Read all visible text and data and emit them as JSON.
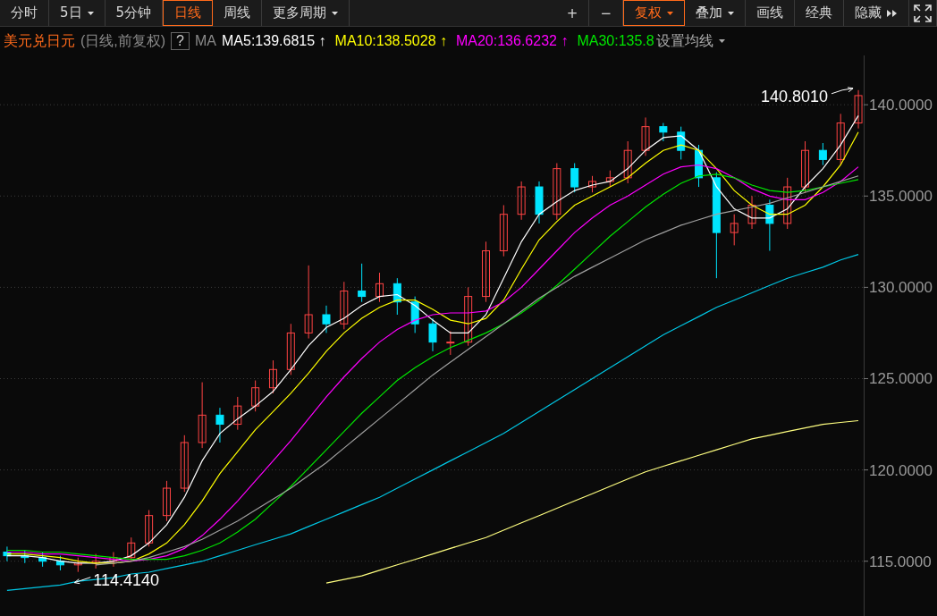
{
  "toolbar": {
    "left_tabs": [
      {
        "label": "分时",
        "selected": false,
        "has_menu": false
      },
      {
        "label": "5日",
        "selected": false,
        "has_menu": true
      },
      {
        "label": "5分钟",
        "selected": false,
        "has_menu": false
      },
      {
        "label": "日线",
        "selected": true,
        "has_menu": false
      },
      {
        "label": "周线",
        "selected": false,
        "has_menu": false
      },
      {
        "label": "更多周期",
        "selected": false,
        "has_menu": true
      }
    ],
    "right_buttons": [
      {
        "label": "+",
        "selected": false,
        "has_menu": false
      },
      {
        "label": "−",
        "selected": false,
        "has_menu": false
      },
      {
        "label": "复权",
        "selected": true,
        "has_menu": true
      },
      {
        "label": "叠加",
        "selected": false,
        "has_menu": true
      },
      {
        "label": "画线",
        "selected": false,
        "has_menu": false
      },
      {
        "label": "经典",
        "selected": false,
        "has_menu": false
      },
      {
        "label": "隐藏",
        "selected": false,
        "has_menu": false
      }
    ]
  },
  "legend": {
    "symbol": "美元兑日元",
    "period": "(日线,前复权)",
    "help": "?",
    "ma_label": "MA",
    "items": [
      {
        "text": "MA5:139.6815",
        "arrow": "↑",
        "color": "#ffffff"
      },
      {
        "text": "MA10:138.5028",
        "arrow": "↑",
        "color": "#ffff00"
      },
      {
        "text": "MA20:136.6232",
        "arrow": "↑",
        "color": "#ff00ff"
      },
      {
        "text": "MA30:135.8",
        "color": "#00e600"
      }
    ],
    "settings": "设置均线"
  },
  "chart": {
    "chart_data": {
      "type": "candlestick",
      "grid": true,
      "categories": [
        null,
        null,
        null,
        null,
        null,
        null,
        null,
        null,
        null,
        null,
        null,
        null,
        null,
        null,
        null,
        null,
        null,
        null,
        null,
        null,
        null,
        null,
        null,
        null,
        null,
        null,
        null,
        null,
        null,
        null,
        null,
        null,
        null,
        null,
        null,
        null,
        null,
        null,
        null,
        null,
        null,
        null,
        null,
        null,
        null,
        null,
        null,
        null,
        null
      ],
      "ylim": [
        112,
        142.7
      ],
      "yticks": [
        {
          "value": 115,
          "label": "115.0000"
        },
        {
          "value": 120,
          "label": "120.0000"
        },
        {
          "value": 125,
          "label": "125.0000"
        },
        {
          "value": 130,
          "label": "130.0000"
        },
        {
          "value": 135,
          "label": "135.0000"
        },
        {
          "value": 140,
          "label": "140.0000"
        }
      ],
      "ohlc": [
        [
          115.5,
          115.8,
          115.0,
          115.3
        ],
        [
          115.3,
          115.6,
          114.9,
          115.2
        ],
        [
          115.2,
          115.5,
          114.7,
          115.0
        ],
        [
          115.0,
          115.3,
          114.5,
          114.8
        ],
        [
          114.8,
          115.2,
          114.414,
          114.9
        ],
        [
          114.9,
          115.4,
          114.6,
          115.0
        ],
        [
          115.0,
          115.5,
          114.7,
          115.2
        ],
        [
          115.2,
          116.3,
          115.0,
          116.0
        ],
        [
          116.0,
          117.8,
          115.8,
          117.5
        ],
        [
          117.5,
          119.4,
          117.2,
          119.0
        ],
        [
          119.0,
          121.9,
          118.8,
          121.5
        ],
        [
          121.5,
          124.8,
          121.2,
          123.0
        ],
        [
          123.0,
          123.4,
          121.5,
          122.5
        ],
        [
          122.5,
          124.0,
          122.2,
          123.5
        ],
        [
          123.5,
          124.9,
          123.2,
          124.5
        ],
        [
          124.5,
          126.0,
          124.2,
          125.5
        ],
        [
          125.5,
          128.0,
          125.2,
          127.5
        ],
        [
          127.5,
          131.2,
          127.2,
          128.5
        ],
        [
          128.5,
          129.0,
          127.5,
          128.0
        ],
        [
          128.0,
          130.3,
          127.7,
          129.8
        ],
        [
          129.8,
          131.3,
          129.2,
          129.5
        ],
        [
          129.5,
          130.8,
          129.2,
          130.2
        ],
        [
          130.2,
          130.5,
          128.5,
          129.2
        ],
        [
          129.2,
          129.5,
          127.5,
          128.0
        ],
        [
          128.0,
          128.3,
          126.5,
          127.0
        ],
        [
          127.0,
          127.6,
          126.3,
          127.0
        ],
        [
          127.0,
          130.0,
          126.8,
          129.5
        ],
        [
          129.5,
          132.5,
          129.2,
          132.0
        ],
        [
          132.0,
          134.5,
          131.7,
          134.0
        ],
        [
          134.0,
          135.8,
          133.7,
          135.5
        ],
        [
          135.5,
          135.8,
          133.5,
          134.0
        ],
        [
          134.0,
          136.8,
          133.7,
          136.5
        ],
        [
          136.5,
          136.8,
          135.2,
          135.5
        ],
        [
          135.5,
          136.1,
          135.2,
          135.8
        ],
        [
          135.8,
          136.4,
          135.5,
          136.0
        ],
        [
          136.0,
          138.0,
          135.7,
          137.5
        ],
        [
          137.5,
          139.3,
          137.2,
          138.8
        ],
        [
          138.8,
          139.0,
          138.0,
          138.5
        ],
        [
          138.5,
          138.8,
          137.0,
          137.5
        ],
        [
          137.5,
          137.8,
          135.5,
          136.0
        ],
        [
          136.0,
          136.3,
          130.5,
          133.0
        ],
        [
          133.0,
          134.0,
          132.3,
          133.5
        ],
        [
          133.5,
          135.0,
          133.2,
          134.5
        ],
        [
          134.5,
          134.8,
          132.0,
          133.5
        ],
        [
          133.5,
          136.0,
          133.2,
          135.5
        ],
        [
          135.5,
          138.0,
          135.2,
          137.5
        ],
        [
          137.5,
          137.9,
          136.7,
          137.0
        ],
        [
          137.0,
          139.5,
          136.7,
          139.0
        ],
        [
          139.0,
          140.801,
          138.7,
          140.5
        ]
      ],
      "series": [
        {
          "type": "line",
          "color": "#ffffff",
          "values": [
            115.3,
            115.3,
            115.2,
            115.0,
            114.9,
            114.9,
            115.0,
            115.3,
            116.0,
            117.0,
            118.5,
            120.5,
            122.0,
            122.8,
            123.5,
            124.3,
            125.5,
            126.8,
            127.8,
            128.3,
            129.0,
            129.5,
            129.6,
            129.0,
            128.2,
            127.5,
            127.5,
            128.5,
            130.5,
            132.5,
            134.0,
            134.7,
            135.3,
            135.6,
            135.8,
            136.5,
            137.5,
            138.2,
            138.3,
            137.5,
            135.5,
            134.3,
            133.8,
            133.8,
            134.3,
            135.5,
            136.5,
            137.8,
            139.4
          ]
        },
        {
          "type": "line",
          "color": "#ffff00",
          "values": [
            115.4,
            115.4,
            115.3,
            115.2,
            115.0,
            114.9,
            114.9,
            115.0,
            115.4,
            116.0,
            117.0,
            118.3,
            119.8,
            121.0,
            122.2,
            123.2,
            124.2,
            125.3,
            126.5,
            127.5,
            128.3,
            128.9,
            129.3,
            129.3,
            128.8,
            128.2,
            128.0,
            128.3,
            129.3,
            131.0,
            132.6,
            133.6,
            134.5,
            135.0,
            135.5,
            136.0,
            136.8,
            137.5,
            137.8,
            137.5,
            136.5,
            135.3,
            134.5,
            134.0,
            134.0,
            134.5,
            135.5,
            136.7,
            138.5
          ]
        },
        {
          "type": "line",
          "color": "#ff00ff",
          "values": [
            115.5,
            115.5,
            115.4,
            115.4,
            115.3,
            115.2,
            115.1,
            115.0,
            115.1,
            115.3,
            115.7,
            116.4,
            117.3,
            118.3,
            119.4,
            120.5,
            121.6,
            122.8,
            124.0,
            125.1,
            126.1,
            127.0,
            127.7,
            128.2,
            128.5,
            128.6,
            128.6,
            128.7,
            129.2,
            130.0,
            131.0,
            132.0,
            133.0,
            133.8,
            134.5,
            135.0,
            135.6,
            136.2,
            136.6,
            136.7,
            136.5,
            136.0,
            135.4,
            135.0,
            134.8,
            134.8,
            135.2,
            135.8,
            136.6
          ]
        },
        {
          "type": "line",
          "color": "#00e600",
          "values": [
            115.6,
            115.6,
            115.5,
            115.5,
            115.4,
            115.3,
            115.2,
            115.1,
            115.1,
            115.1,
            115.3,
            115.6,
            116.0,
            116.6,
            117.3,
            118.2,
            119.1,
            120.1,
            121.1,
            122.1,
            123.1,
            124.0,
            124.9,
            125.6,
            126.2,
            126.7,
            127.1,
            127.5,
            128.0,
            128.6,
            129.3,
            130.1,
            131.0,
            131.9,
            132.8,
            133.6,
            134.4,
            135.1,
            135.7,
            136.1,
            136.2,
            136.0,
            135.6,
            135.3,
            135.2,
            135.3,
            135.5,
            135.7,
            135.9
          ]
        },
        {
          "type": "line",
          "color": "#a0a0a0",
          "values": [
            null,
            null,
            null,
            null,
            null,
            114.8,
            114.9,
            115.0,
            115.2,
            115.5,
            115.8,
            116.2,
            116.7,
            117.2,
            117.8,
            118.4,
            119.0,
            119.7,
            120.4,
            121.2,
            122.0,
            122.8,
            123.6,
            124.4,
            125.2,
            125.9,
            126.6,
            127.3,
            128.0,
            128.7,
            129.4,
            130.0,
            130.6,
            131.1,
            131.6,
            132.1,
            132.6,
            133.0,
            133.4,
            133.7,
            134.0,
            134.2,
            134.4,
            134.6,
            134.9,
            135.2,
            135.5,
            135.8,
            136.1
          ]
        },
        {
          "type": "line",
          "color": "#00c8e6",
          "values": [
            113.4,
            113.5,
            113.6,
            113.7,
            113.9,
            114.0,
            114.1,
            114.3,
            114.4,
            114.6,
            114.8,
            115.0,
            115.3,
            115.6,
            115.9,
            116.2,
            116.5,
            116.9,
            117.3,
            117.7,
            118.1,
            118.5,
            119.0,
            119.5,
            120.0,
            120.5,
            121.0,
            121.5,
            122.0,
            122.6,
            123.2,
            123.8,
            124.4,
            125.0,
            125.6,
            126.2,
            126.8,
            127.4,
            127.9,
            128.4,
            128.9,
            129.3,
            129.7,
            130.1,
            130.5,
            130.8,
            131.1,
            131.5,
            131.8
          ]
        },
        {
          "type": "line",
          "color": "#ffff80",
          "values": [
            null,
            null,
            null,
            null,
            null,
            null,
            null,
            null,
            null,
            null,
            null,
            null,
            null,
            null,
            null,
            null,
            null,
            null,
            113.8,
            114.0,
            114.2,
            114.5,
            114.8,
            115.1,
            115.4,
            115.7,
            116.0,
            116.3,
            116.7,
            117.1,
            117.5,
            117.9,
            118.3,
            118.7,
            119.1,
            119.5,
            119.9,
            120.2,
            120.5,
            120.8,
            121.1,
            121.4,
            121.7,
            121.9,
            122.1,
            122.3,
            122.5,
            122.6,
            122.7
          ]
        }
      ],
      "annotations": [
        "140.8010",
        "114.4140"
      ]
    }
  }
}
